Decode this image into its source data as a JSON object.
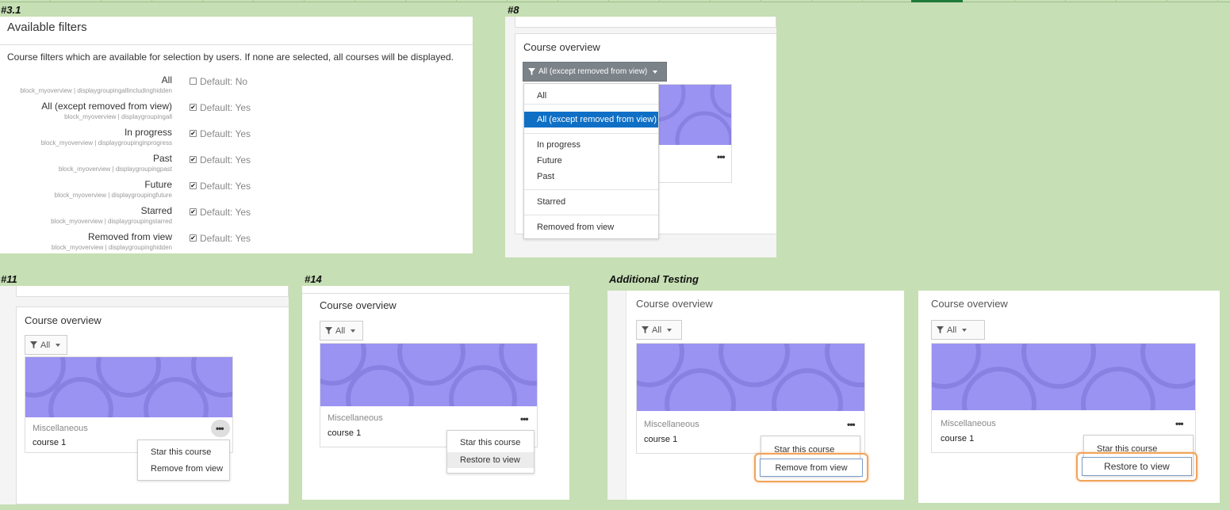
{
  "labels": {
    "p1": "#3.1",
    "p2": "#8",
    "p3": "#11",
    "p4": "#14",
    "p5": "Additional Testing"
  },
  "available_filters": {
    "title": "Available filters",
    "description": "Course filters which are available for selection by users. If none are selected, all courses will be displayed.",
    "filters": [
      {
        "label": "All",
        "setting": "block_myoverview | displaygroupingallincludinghidden",
        "checked": false,
        "default": "Default: No"
      },
      {
        "label": "All (except removed from view)",
        "setting": "block_myoverview | displaygroupingall",
        "checked": true,
        "default": "Default: Yes"
      },
      {
        "label": "In progress",
        "setting": "block_myoverview | displaygroupinginprogress",
        "checked": true,
        "default": "Default: Yes"
      },
      {
        "label": "Past",
        "setting": "block_myoverview | displaygroupingpast",
        "checked": true,
        "default": "Default: Yes"
      },
      {
        "label": "Future",
        "setting": "block_myoverview | displaygroupingfuture",
        "checked": true,
        "default": "Default: Yes"
      },
      {
        "label": "Starred",
        "setting": "block_myoverview | displaygroupingstarred",
        "checked": true,
        "default": "Default: Yes"
      },
      {
        "label": "Removed from view",
        "setting": "block_myoverview | displaygroupinghidden",
        "checked": true,
        "default": "Default: Yes"
      }
    ]
  },
  "dropdown_panel": {
    "title": "Course overview",
    "button": "All (except removed from view)",
    "items": [
      "All",
      "All (except removed from view)",
      "In progress",
      "Future",
      "Past",
      "Starred",
      "Removed from view"
    ],
    "selected": "All (except removed from view)"
  },
  "course_panels": {
    "title": "Course overview",
    "filter": "All",
    "category": "Miscellaneous",
    "course": "course 1",
    "star": "Star this course",
    "remove": "Remove from view",
    "restore": "Restore to view"
  },
  "colors": {
    "background": "#c6dfb4",
    "card_image": "#9a93f2",
    "selected_item": "#0f6fc5",
    "highlight": "#f1a35a"
  },
  "icons": [
    "filter-icon",
    "caret-down-icon",
    "more-icon",
    "checkbox-icon"
  ]
}
